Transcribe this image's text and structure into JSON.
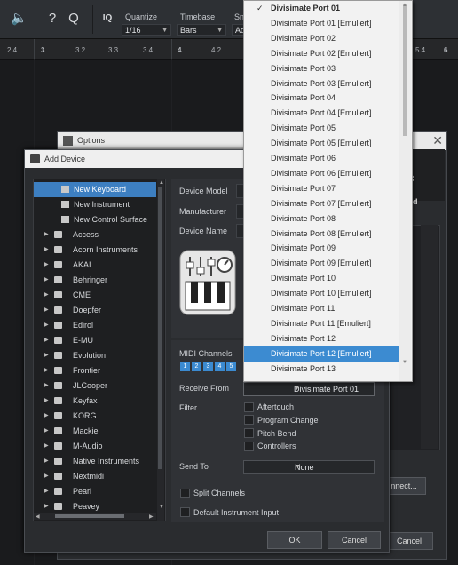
{
  "toolbar": {
    "quantize_label": "Quantize",
    "quantize_value": "1/16",
    "timebase_label": "Timebase",
    "timebase_value": "Bars",
    "snap_label": "Sn",
    "snap_value": "Ad",
    "iq_label": "IQ",
    "help_glyph": "?",
    "search_glyph": "Q"
  },
  "ruler": {
    "ticks": [
      "2.4",
      "3",
      "3.2",
      "3.3",
      "3.4",
      "4",
      "4.2",
      "5.4",
      "6"
    ]
  },
  "options_window": {
    "title": "Options",
    "close_glyph": "✕",
    "tab_label": "ced",
    "connect_label": "nnect...",
    "cancel_label": "Cancel"
  },
  "add_device": {
    "title": "Add Device",
    "tree": [
      {
        "label": "New Keyboard",
        "kind": "keyboard",
        "selected": true
      },
      {
        "label": "New Instrument",
        "kind": "instrument"
      },
      {
        "label": "New Control Surface",
        "kind": "surface"
      },
      {
        "label": "Access",
        "kind": "folder"
      },
      {
        "label": "Acorn Instruments",
        "kind": "folder"
      },
      {
        "label": "AKAI",
        "kind": "folder"
      },
      {
        "label": "Behringer",
        "kind": "folder"
      },
      {
        "label": "CME",
        "kind": "folder"
      },
      {
        "label": "Doepfer",
        "kind": "folder"
      },
      {
        "label": "Edirol",
        "kind": "folder"
      },
      {
        "label": "E-MU",
        "kind": "folder"
      },
      {
        "label": "Evolution",
        "kind": "folder"
      },
      {
        "label": "Frontier",
        "kind": "folder"
      },
      {
        "label": "JLCooper",
        "kind": "folder"
      },
      {
        "label": "Keyfax",
        "kind": "folder"
      },
      {
        "label": "KORG",
        "kind": "folder"
      },
      {
        "label": "Mackie",
        "kind": "folder"
      },
      {
        "label": "M-Audio",
        "kind": "folder"
      },
      {
        "label": "Native Instruments",
        "kind": "folder"
      },
      {
        "label": "Nextmidi",
        "kind": "folder"
      },
      {
        "label": "Pearl",
        "kind": "folder"
      },
      {
        "label": "Peavey",
        "kind": "folder"
      }
    ],
    "device_model_label": "Device Model",
    "manufacturer_label": "Manufacturer",
    "device_name_label": "Device Name",
    "midi_channels_label": "MIDI Channels",
    "midi_channels": [
      "1",
      "2",
      "3",
      "4",
      "5"
    ],
    "receive_from_label": "Receive From",
    "receive_from_value": "Divisimate Port 01",
    "filter_label": "Filter",
    "filters": [
      "Aftertouch",
      "Program Change",
      "Pitch Bend",
      "Controllers"
    ],
    "send_to_label": "Send To",
    "send_to_value": "None",
    "split_channels_label": "Split Channels",
    "default_instrument_label": "Default Instrument Input",
    "ok_label": "OK",
    "cancel_label": "Cancel"
  },
  "dropdown": {
    "checked_item": "Divisimate Port 01",
    "highlighted_item": "Divisimate Port 12 [Emuliert]",
    "items": [
      "Divisimate Port 01",
      "Divisimate Port 01 [Emuliert]",
      "Divisimate Port 02",
      "Divisimate Port 02 [Emuliert]",
      "Divisimate Port 03",
      "Divisimate Port 03 [Emuliert]",
      "Divisimate Port 04",
      "Divisimate Port 04 [Emuliert]",
      "Divisimate Port 05",
      "Divisimate Port 05 [Emuliert]",
      "Divisimate Port 06",
      "Divisimate Port 06 [Emuliert]",
      "Divisimate Port 07",
      "Divisimate Port 07 [Emuliert]",
      "Divisimate Port 08",
      "Divisimate Port 08 [Emuliert]",
      "Divisimate Port 09",
      "Divisimate Port 09 [Emuliert]",
      "Divisimate Port 10",
      "Divisimate Port 10 [Emuliert]",
      "Divisimate Port 11",
      "Divisimate Port 11 [Emuliert]",
      "Divisimate Port 12",
      "Divisimate Port 12 [Emuliert]",
      "Divisimate Port 13"
    ]
  },
  "colors": {
    "selection_blue": "#3c8bd1",
    "toolbar_bg": "#2d3034",
    "dialog_bg": "#2a2c2f"
  }
}
